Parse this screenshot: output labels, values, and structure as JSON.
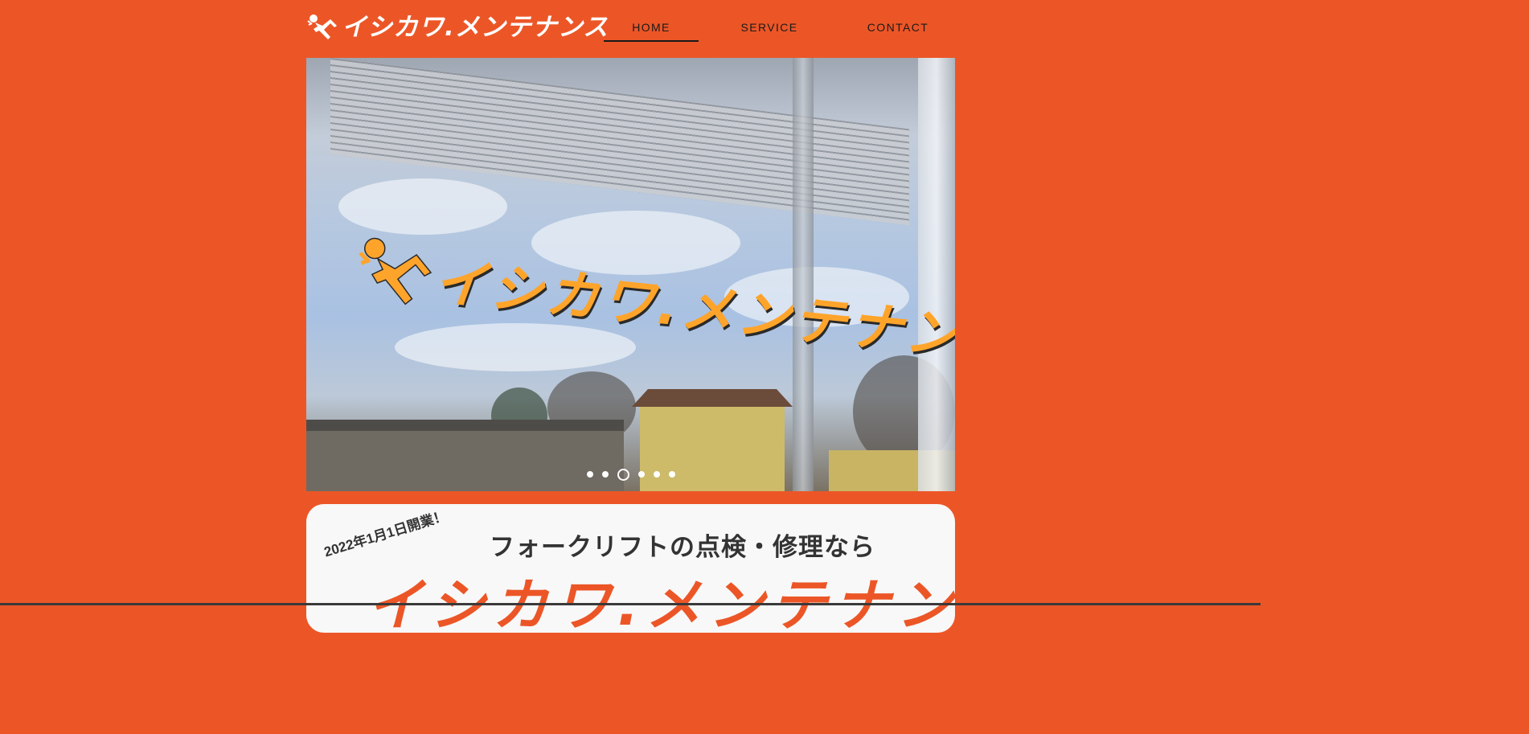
{
  "brand": {
    "name": "イシカワ.メンテナンス",
    "color": "#ffffff"
  },
  "nav": {
    "items": [
      {
        "label": "HOME",
        "active": true
      },
      {
        "label": "SERVICE",
        "active": false
      },
      {
        "label": "CONTACT",
        "active": false
      }
    ]
  },
  "hero": {
    "sign_text": "イシカワ.メンテナンス",
    "sign_color": "#ffa42b",
    "slides_total": 6,
    "active_slide": 3
  },
  "intro": {
    "opening_date": "2022年1月1日開業！",
    "tagline": "フォークリフトの点検・修理なら",
    "brand": "イシカワ.メンテナンス",
    "brand_color": "#ec5627"
  },
  "colors": {
    "background": "#ec5627",
    "card": "#f8f8f8",
    "text": "#333333"
  }
}
